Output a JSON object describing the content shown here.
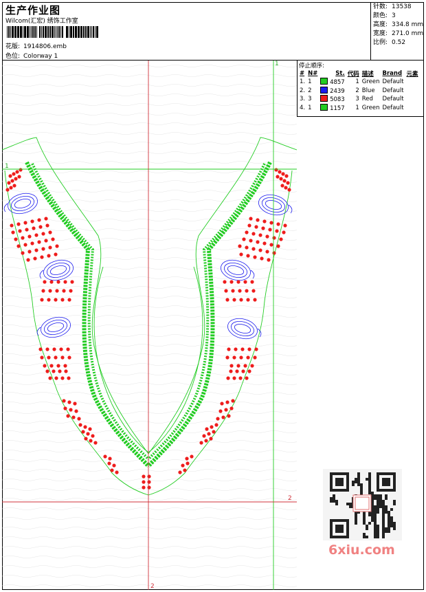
{
  "header": {
    "title": "生产作业图",
    "company": "Wilcom(汇宏) 绣饰工作室",
    "design_label": "花版:",
    "design_value": "1914806.emb",
    "colorway_label": "色位:",
    "colorway_value": "Colorway 1"
  },
  "stats": [
    {
      "label": "针数:",
      "value": "13538"
    },
    {
      "label": "颜色:",
      "value": "3"
    },
    {
      "label": "高度:",
      "value": "334.8 mm"
    },
    {
      "label": "宽度:",
      "value": "271.0 mm"
    },
    {
      "label": "比例:",
      "value": "0.52"
    }
  ],
  "stop_sequence": {
    "heading": "停止顺序:",
    "columns": [
      "#",
      "N#",
      "St.",
      "代码",
      "描述",
      "Brand",
      "元素"
    ],
    "rows": [
      {
        "idx": "1.",
        "n": "1",
        "color": "#22cc22",
        "st": "4857",
        "code": "1",
        "desc": "Green",
        "brand": "Default"
      },
      {
        "idx": "2.",
        "n": "2",
        "color": "#1a1aee",
        "st": "2439",
        "code": "2",
        "desc": "Blue",
        "brand": "Default"
      },
      {
        "idx": "3.",
        "n": "3",
        "color": "#ee1c1c",
        "st": "5083",
        "code": "3",
        "desc": "Red",
        "brand": "Default"
      },
      {
        "idx": "4.",
        "n": "1",
        "color": "#22cc22",
        "st": "1157",
        "code": "1",
        "desc": "Green",
        "brand": "Default"
      }
    ]
  },
  "markers": {
    "top": "1",
    "left": "1",
    "right": "2",
    "bottom": "2"
  },
  "watermark": "6xiu.com",
  "colors": {
    "green": "#22cc22",
    "blue": "#1a1aee",
    "red": "#ee1c1c",
    "guide": "#d0303a"
  }
}
